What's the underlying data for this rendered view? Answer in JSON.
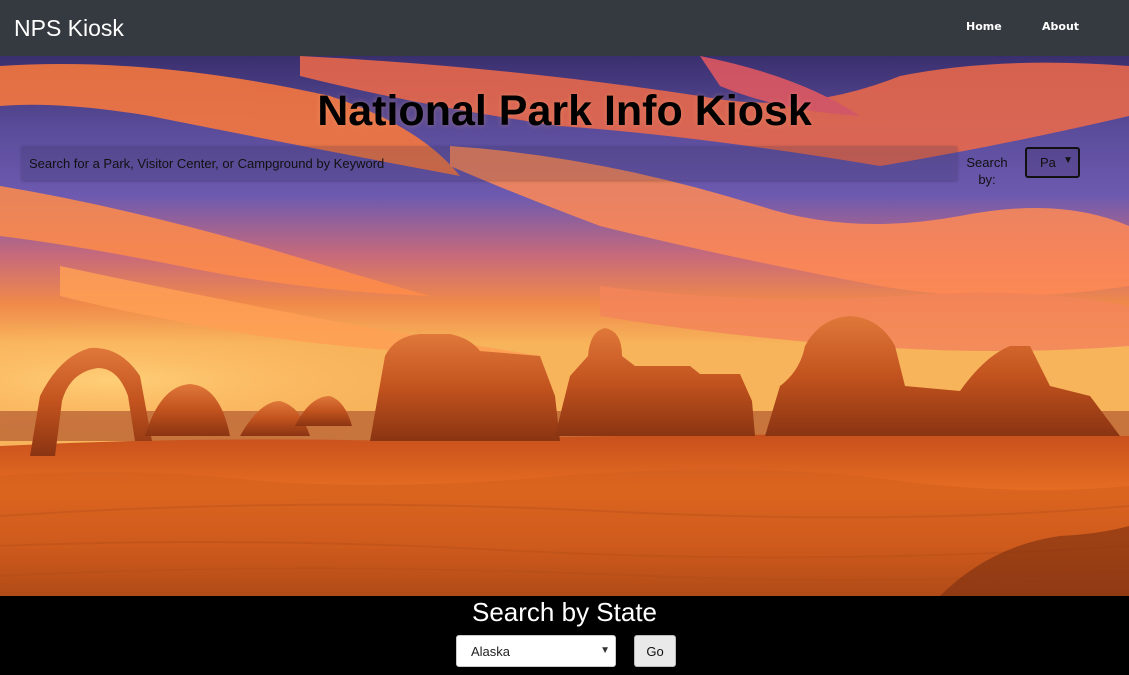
{
  "navbar": {
    "brand": "NPS Kiosk",
    "links": [
      {
        "label": "Home"
      },
      {
        "label": "About"
      }
    ]
  },
  "hero": {
    "title": "National Park Info Kiosk",
    "search_placeholder": "Search for a Park, Visitor Center, or Campground by Keyword",
    "search_by_label": "Search by:",
    "search_type_selected": "Parks",
    "background_image": "desert-arches-sunset"
  },
  "state_search": {
    "title": "Search by State",
    "selected_state": "Alaska",
    "go_label": "Go"
  },
  "colors": {
    "navbar": "#343a40",
    "footer": "#000000",
    "title_text": "#000000"
  }
}
